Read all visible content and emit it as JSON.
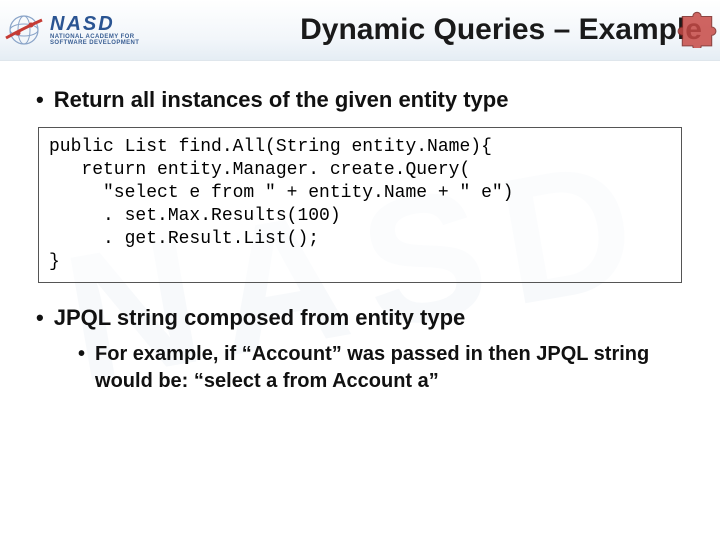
{
  "logo": {
    "main": "NASD",
    "sub": "NATIONAL ACADEMY FOR\nSOFTWARE DEVELOPMENT"
  },
  "title": "Dynamic Queries – Example",
  "bullets": {
    "b1": "Return all instances of the given entity type",
    "code": "public List find.All(String entity.Name){\n   return entity.Manager. create.Query(\n     \"select e from \" + entity.Name + \" e\")\n     . set.Max.Results(100)\n     . get.Result.List();\n}",
    "b2": "JPQL string composed from entity type",
    "sub": "For example, if “Account” was passed in then JPQL string would be: “select a from Account a”"
  }
}
